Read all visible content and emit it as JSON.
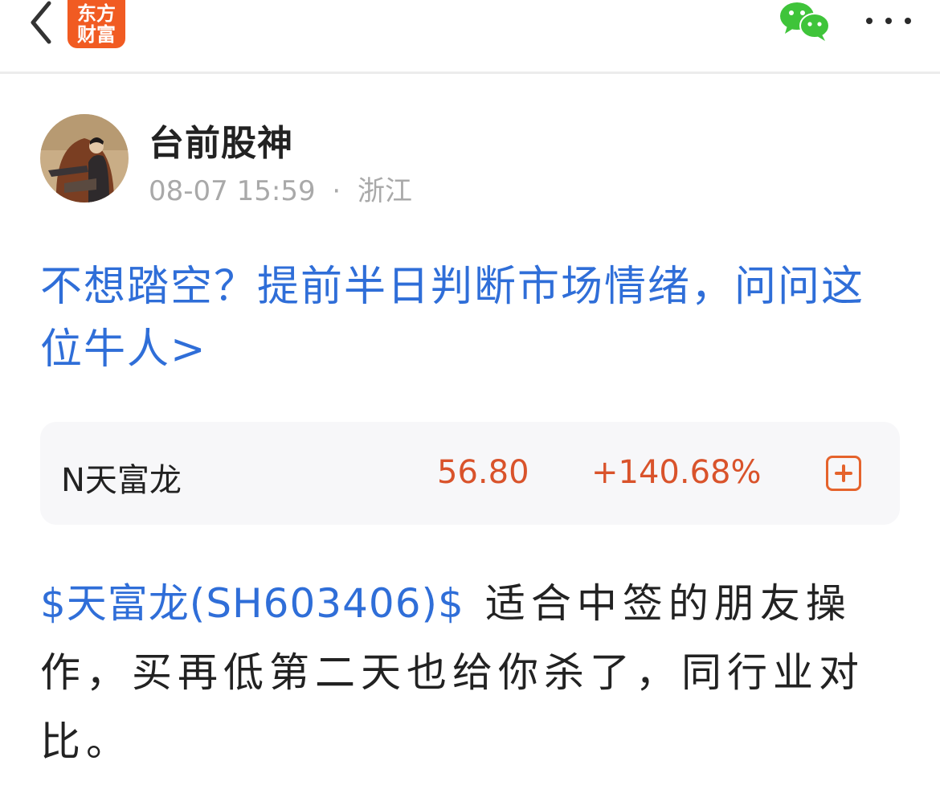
{
  "header": {
    "logo_line1": "东方",
    "logo_line2": "财富"
  },
  "author": {
    "name": "台前股神",
    "date": "08-07 15:59",
    "separator": "·",
    "location": "浙江"
  },
  "promo": {
    "text": "不想踏空？提前半日判断市场情绪，问问这位牛人>"
  },
  "stock_card": {
    "name": "N天富龙",
    "price": "56.80",
    "change": "+140.68%"
  },
  "post": {
    "stock_tag": "$天富龙(SH603406)$",
    "text": "适合中签的朋友操作，买再低第二天也给你杀了，同行业对比。"
  },
  "colors": {
    "link": "#2f6ed8",
    "up": "#d9532b",
    "brand": "#f15b22",
    "wechat": "#3fc43a"
  }
}
